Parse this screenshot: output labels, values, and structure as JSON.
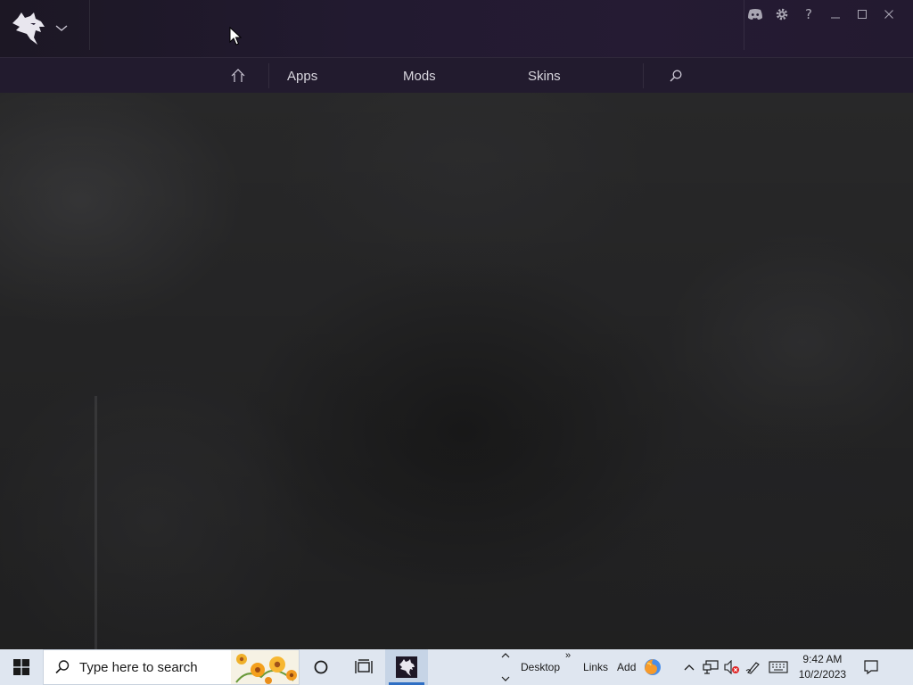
{
  "app": {
    "nav": {
      "apps_label": "Apps",
      "mods_label": "Mods",
      "skins_label": "Skins"
    },
    "window_controls": [
      "discord-icon",
      "gear-icon",
      "help-icon",
      "minimize-icon",
      "maximize-icon",
      "close-icon"
    ],
    "help_glyph": "?"
  },
  "taskbar": {
    "search_placeholder": "Type here to search",
    "toolbars": {
      "desktop": "Desktop",
      "overflow": "»",
      "links": "Links",
      "add": "Add"
    },
    "clock": {
      "time": "9:42 AM",
      "date": "10/2/2023"
    }
  },
  "colors": {
    "titlebar": "#221a30",
    "navbar": "#221b2e",
    "nav_text": "#d8d6de",
    "taskbar": "#dfe6f0",
    "accent": "#2f6fc4"
  }
}
